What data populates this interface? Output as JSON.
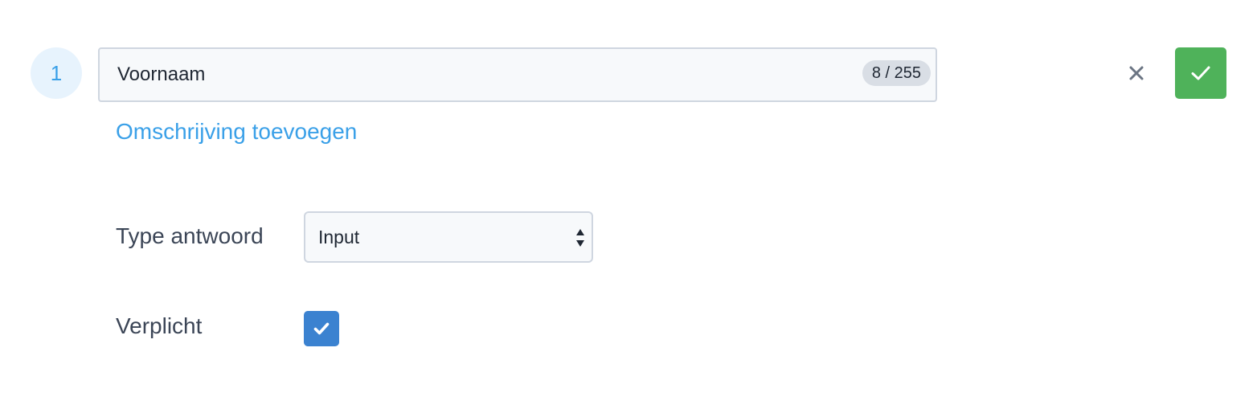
{
  "question": {
    "number": "1",
    "title_value": "Voornaam",
    "char_counter": "8 / 255"
  },
  "actions": {
    "cancel_icon": "close-icon",
    "confirm_icon": "check-icon",
    "confirm_color": "#4fb25a"
  },
  "description_link": "Omschrijving toevoegen",
  "answer_type": {
    "label": "Type antwoord",
    "selected": "Input"
  },
  "required": {
    "label": "Verplicht",
    "checked": true,
    "color": "#3b82d0"
  },
  "colors": {
    "accent": "#3aa0e8",
    "badge_bg": "#e7f3fd"
  }
}
